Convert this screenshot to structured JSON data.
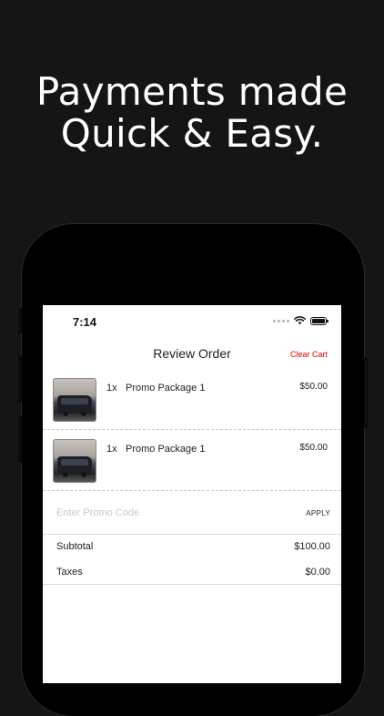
{
  "headline": {
    "line1": "Payments made",
    "line2": "Quick & Easy."
  },
  "status_bar": {
    "time": "7:14"
  },
  "nav": {
    "title": "Review Order",
    "clear_cart": "Clear Cart"
  },
  "cart_items": [
    {
      "qty": "1x",
      "name": "Promo Package 1",
      "price": "$50.00"
    },
    {
      "qty": "1x",
      "name": "Promo Package 1",
      "price": "$50.00"
    }
  ],
  "promo": {
    "placeholder": "Enter Promo Code",
    "value": "",
    "apply_label": "APPLY"
  },
  "summary": {
    "subtotal_label": "Subtotal",
    "subtotal_value": "$100.00",
    "taxes_label": "Taxes",
    "taxes_value": "$0.00"
  },
  "colors": {
    "background": "#151515",
    "accent": "#e00000"
  }
}
